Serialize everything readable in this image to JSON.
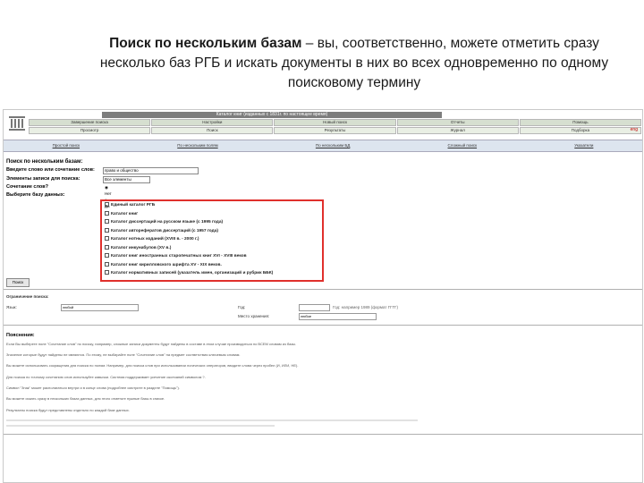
{
  "slide": {
    "title_bold_prefix": "Поиск ",
    "title_bold": "по нескольким базам",
    "title_rest": " – вы, соответственно, можете отметить сразу несколько баз РГБ и искать документы в них во всех одновременно по одному поисковому термину"
  },
  "screenshot": {
    "header_bar": "Каталог книг (изданных с 1831г. по настоящее время)",
    "nav_row1": [
      "Завершение поиска",
      "Настройки",
      "Новый поиск",
      "Отчеты",
      "Помощь"
    ],
    "nav_row2": [
      "Просмотр",
      "Поиск",
      "Результаты",
      "Журнал",
      "Подборка"
    ],
    "lang_link": "eng",
    "tabs": [
      "Простой поиск",
      "По нескольким полям",
      "По нескольким БД",
      "Сложный поиск",
      "Указатели"
    ],
    "form": {
      "title": "Поиск по нескольким базам:",
      "word_label": "Введите слово или сочетание слов:",
      "word_value": "право и общество",
      "elements_label": "Элементы записи для поиска:",
      "elements_value": "Все элементы",
      "combo_label": "Сочетание слов?",
      "radio_no": "Нет",
      "radio_yes": "Да",
      "choose_label": "Выберите базу данных:"
    },
    "databases": [
      "Единый каталог РГБ",
      "Каталог книг",
      "Каталог диссертаций на русском языке (с 1995 года)",
      "Каталог авторефератов диссертаций (с 1957 года)",
      "Каталог нотных изданий (XVIII в. - 2000 г.)",
      "Каталог инкунабулов (XV в.)",
      "Каталог книг иностранных старопечатных книг XVI - XVIII веков",
      "Каталог книг кирилловского шрифта XV - XIX веков.",
      "Каталог нормативных записей (указатель имен, организаций и рубрик ББК)"
    ],
    "search_button": "Поиск",
    "limits": {
      "title": "Ограничение поиска:",
      "lang_label": "Язык:",
      "lang_value": "любой",
      "year_label": "Год:",
      "year_hint": "Год: например 1989 (формат ГГГГ)",
      "media_label": "Место хранения:",
      "media_value": "любое"
    },
    "explain_title": "Пояснения:",
    "notes": [
      "Если Вы выберете поле \"Сочетание слов\" по поиску, например, сложные записи документы будут найдены в составе в этом случае производиться по ВСЕМ словам из базы.",
      "Значение которые будут найдены не являются. По этому, не выбирайте поле \"Сочетание слов\" на предмет соответствия ключевым словам.",
      "Вы можете использовать сокращения для поиска по полям. Например, для поиска слов при использовании логических операторов, вводите слова через пробел (И, ИЛИ, НЕ).",
      "Для поиска по точному сочетанию слов используйте кавычки. Система поддерживает усечение окончаний символом ?.",
      "Символ \"Знак\" может располагаться внутри и в конце слова (подробнее смотрите в разделе \"Помощь\").",
      "Вы можете искать сразу в нескольких базах данных, для этого отметьте нужные базы в списке.",
      "Результаты поиска будут представлены отдельно по каждой базе данных."
    ]
  }
}
